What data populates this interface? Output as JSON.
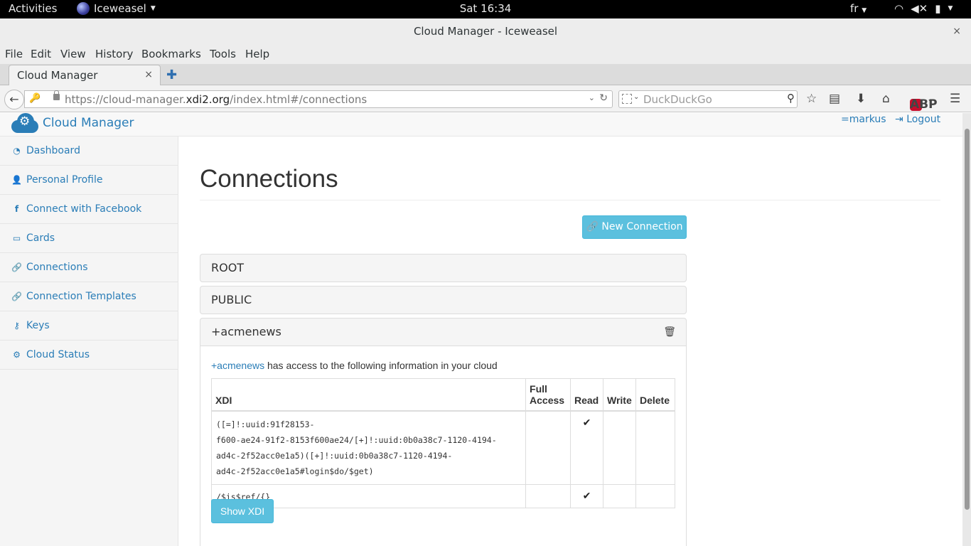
{
  "topbar": {
    "activities": "Activities",
    "app_name": "Iceweasel",
    "clock": "Sat 16:34",
    "lang": "fr"
  },
  "window": {
    "title": "Cloud Manager - Iceweasel",
    "close": "×"
  },
  "menu": [
    "File",
    "Edit",
    "View",
    "History",
    "Bookmarks",
    "Tools",
    "Help"
  ],
  "tab": {
    "title": "Cloud Manager",
    "close": "×",
    "new": "✚"
  },
  "urlbar": {
    "prefix": "https://cloud-manager.",
    "domain": "xdi2.org",
    "path": "/index.html#/connections"
  },
  "search": {
    "placeholder": "DuckDuckGo"
  },
  "app": {
    "brand": "Cloud Manager",
    "user": "=markus",
    "logout": "Logout"
  },
  "sidebar": {
    "items": [
      {
        "label": "Dashboard",
        "icon": "dashboard-icon"
      },
      {
        "label": "Personal Profile",
        "icon": "user-icon"
      },
      {
        "label": "Connect with Facebook",
        "icon": "facebook-icon"
      },
      {
        "label": "Cards",
        "icon": "card-icon"
      },
      {
        "label": "Connections",
        "icon": "link-icon"
      },
      {
        "label": "Connection Templates",
        "icon": "link-icon"
      },
      {
        "label": "Keys",
        "icon": "key-icon"
      },
      {
        "label": "Cloud Status",
        "icon": "cogs-icon"
      }
    ]
  },
  "main": {
    "title": "Connections",
    "new_button": "New Connection",
    "panels": [
      {
        "title": "ROOT"
      },
      {
        "title": "PUBLIC"
      },
      {
        "title": "+acmenews"
      }
    ],
    "access_link": "+acmenews",
    "access_text": " has access to the following information in your cloud",
    "table": {
      "headers": [
        "XDI",
        "Full Access",
        "Read",
        "Write",
        "Delete"
      ],
      "rows": [
        {
          "xdi_lines": [
            "([=]!:uuid:91f28153-",
            "f600-ae24-91f2-8153f600ae24/[+]!:uuid:0b0a38c7-1120-4194-",
            "ad4c-2f52acc0e1a5)([+]!:uuid:0b0a38c7-1120-4194-",
            "ad4c-2f52acc0e1a5#login$do/$get)"
          ],
          "full": "",
          "read": "✔",
          "write": "",
          "delete": ""
        },
        {
          "xdi_lines": [
            "/$is$ref/{}"
          ],
          "full": "",
          "read": "✔",
          "write": "",
          "delete": ""
        }
      ]
    },
    "show_button": "Show XDI"
  }
}
